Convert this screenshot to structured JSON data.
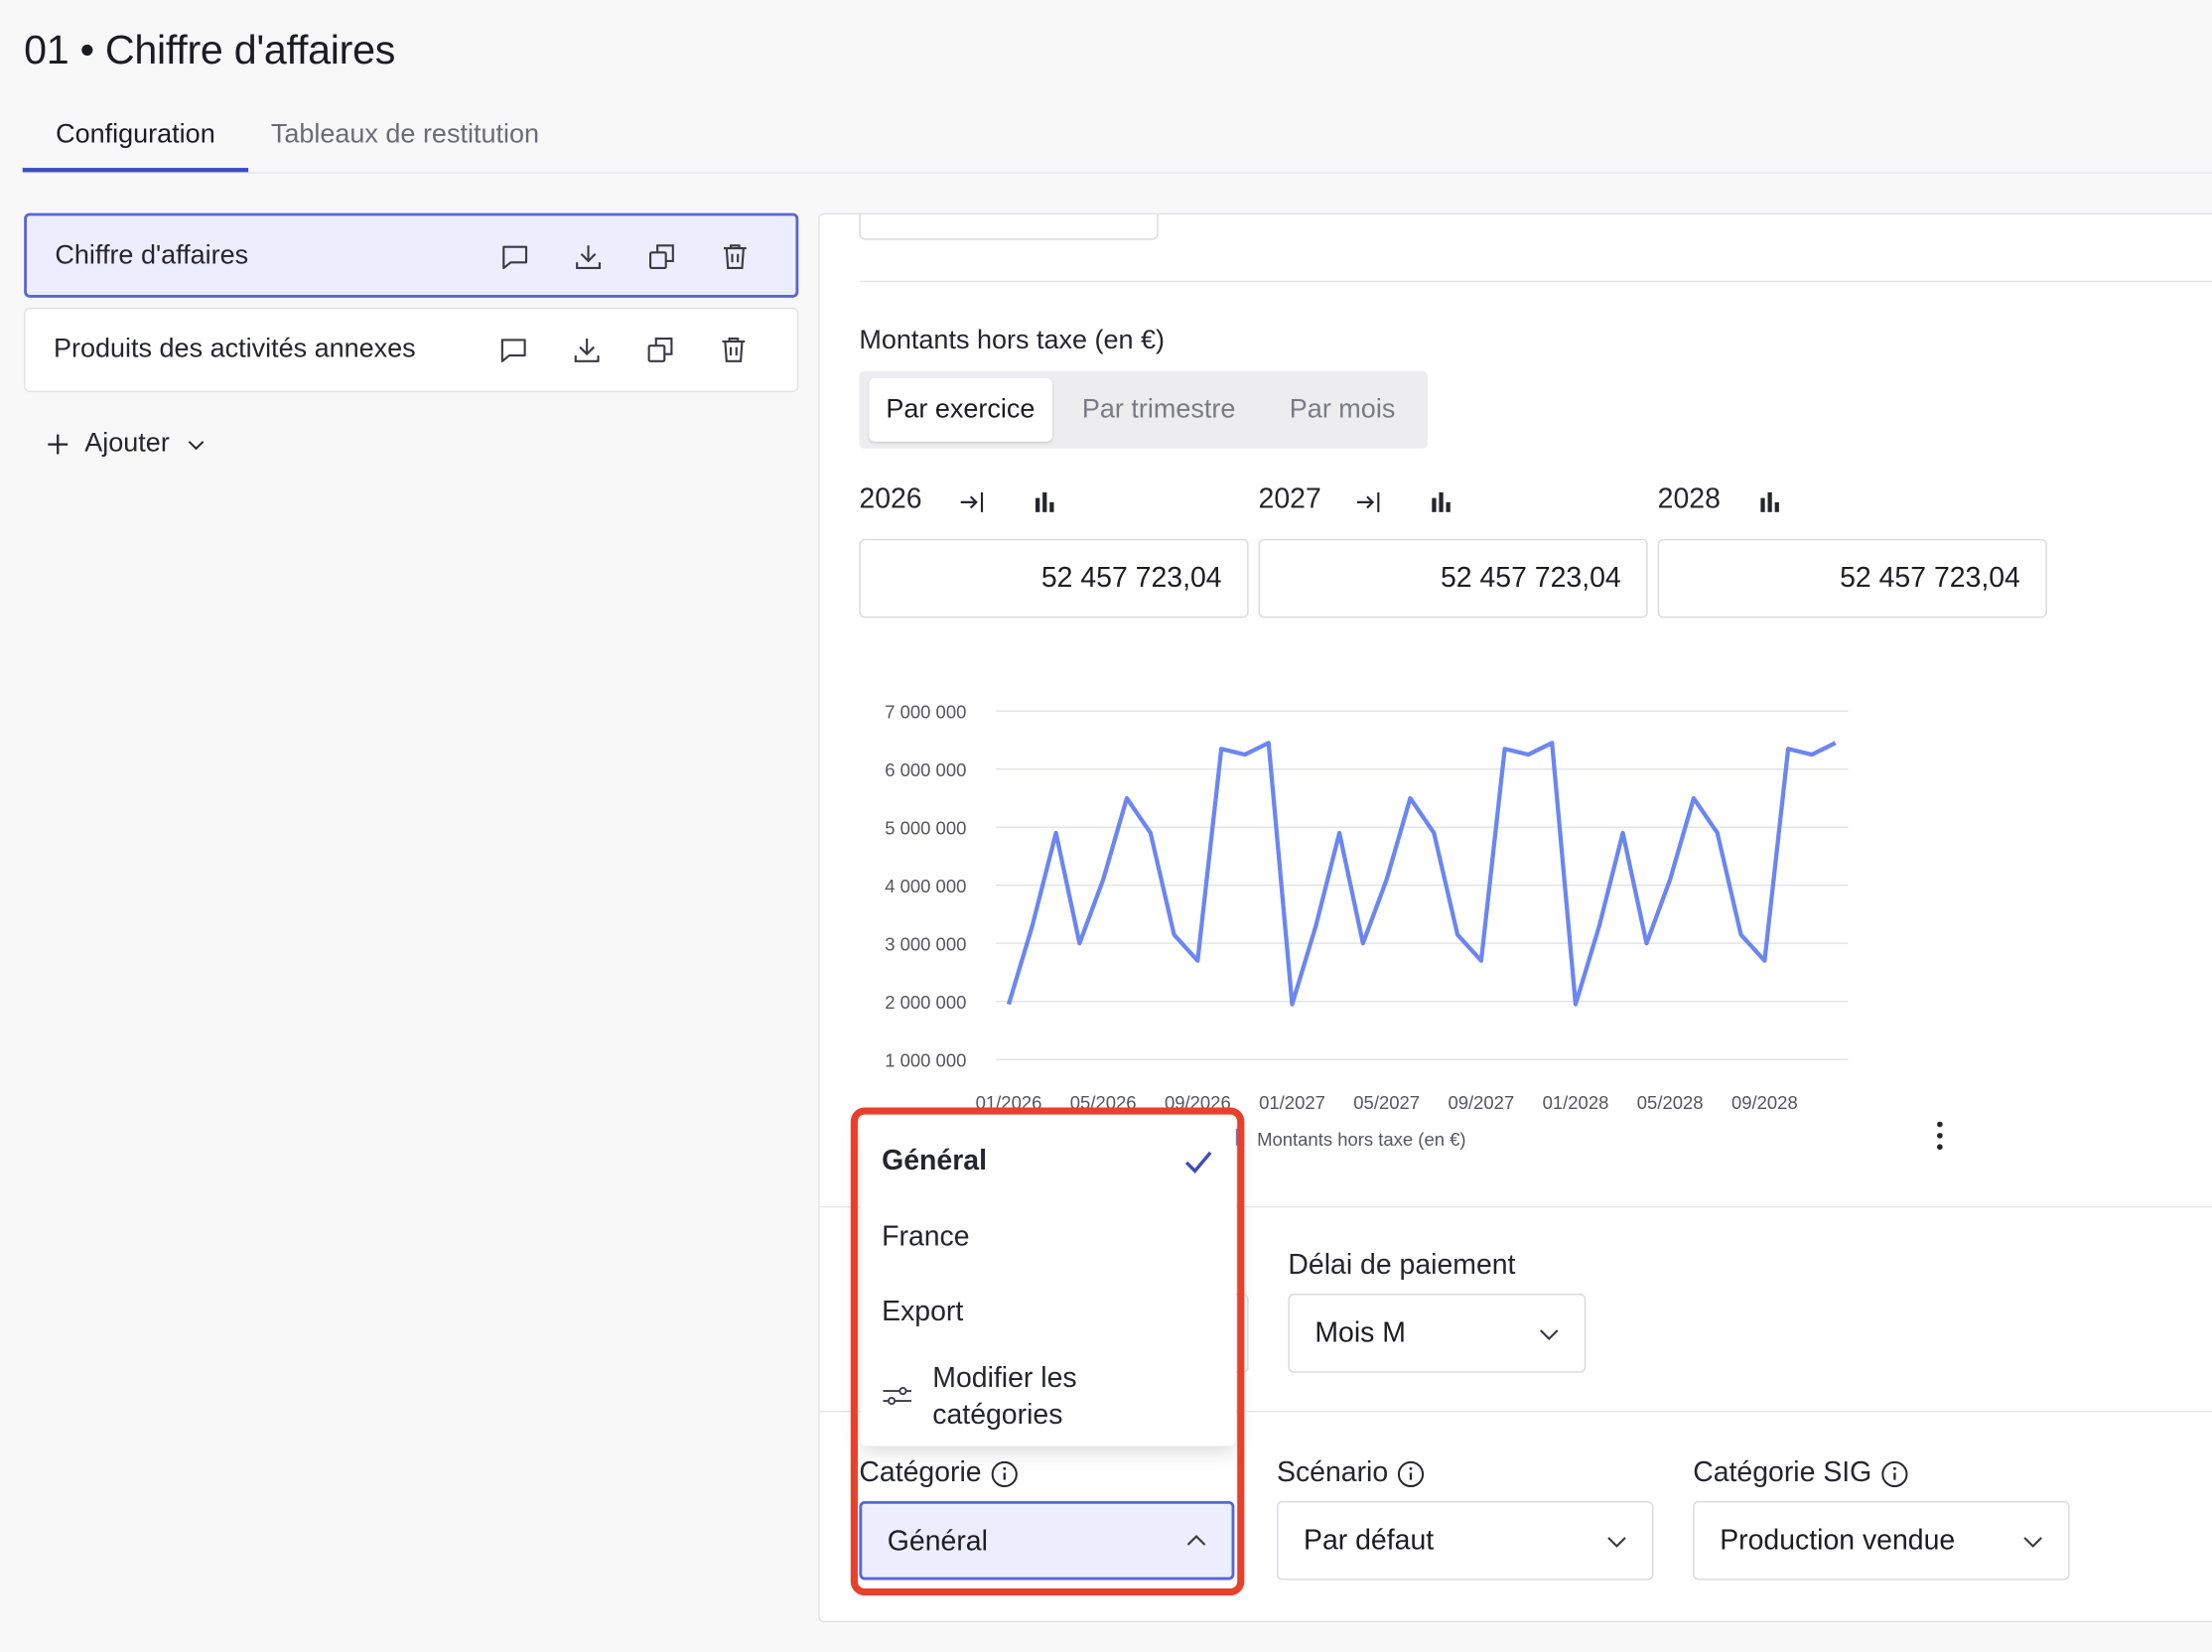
{
  "page": {
    "title": "01 • Chiffre d'affaires"
  },
  "tabs": [
    {
      "label": "Configuration"
    },
    {
      "label": "Tableaux de restitution"
    }
  ],
  "sidebar": {
    "items": [
      {
        "label": "Chiffre d'affaires"
      },
      {
        "label": "Produits des activités annexes"
      }
    ],
    "add_label": "Ajouter"
  },
  "amounts": {
    "title": "Montants hors taxe (en €)",
    "periods": [
      "Par exercice",
      "Par trimestre",
      "Par mois"
    ],
    "years": [
      {
        "year": "2026",
        "value": "52 457 723,04"
      },
      {
        "year": "2027",
        "value": "52 457 723,04"
      },
      {
        "year": "2028",
        "value": "52 457 723,04"
      }
    ]
  },
  "chart_data": {
    "type": "line",
    "x": [
      "01/2026",
      "02/2026",
      "03/2026",
      "04/2026",
      "05/2026",
      "06/2026",
      "07/2026",
      "08/2026",
      "09/2026",
      "10/2026",
      "11/2026",
      "12/2026",
      "01/2027",
      "02/2027",
      "03/2027",
      "04/2027",
      "05/2027",
      "06/2027",
      "07/2027",
      "08/2027",
      "09/2027",
      "10/2027",
      "11/2027",
      "12/2027",
      "01/2028",
      "02/2028",
      "03/2028",
      "04/2028",
      "05/2028",
      "06/2028",
      "07/2028",
      "08/2028",
      "09/2028",
      "10/2028",
      "11/2028",
      "12/2028"
    ],
    "x_tick_labels": [
      "01/2026",
      "05/2026",
      "09/2026",
      "01/2027",
      "05/2027",
      "09/2027",
      "01/2028",
      "05/2028",
      "09/2028"
    ],
    "series": [
      {
        "name": "Montants hors taxe (en €)",
        "color": "#6b86f2",
        "values": [
          1950000,
          3300000,
          4900000,
          3000000,
          4100000,
          5500000,
          4900000,
          3150000,
          2700000,
          6350000,
          6250000,
          6450000,
          1950000,
          3300000,
          4900000,
          3000000,
          4100000,
          5500000,
          4900000,
          3150000,
          2700000,
          6350000,
          6250000,
          6450000,
          1950000,
          3300000,
          4900000,
          3000000,
          4100000,
          5500000,
          4900000,
          3150000,
          2700000,
          6350000,
          6250000,
          6450000
        ]
      }
    ],
    "y_ticks": [
      "1 000 000",
      "2 000 000",
      "3 000 000",
      "4 000 000",
      "5 000 000",
      "6 000 000",
      "7 000 000"
    ],
    "ylim": [
      1000000,
      7000000
    ],
    "grid": true,
    "legend": "bottom"
  },
  "payment": {
    "label": "Délai de paiement",
    "value": "Mois M"
  },
  "category": {
    "label": "Catégorie",
    "value": "Général",
    "options": [
      "Général",
      "France",
      "Export"
    ],
    "edit_label": [
      "Modifier les",
      "catégories"
    ]
  },
  "scenario": {
    "label": "Scénario",
    "value": "Par défaut"
  },
  "sig": {
    "label": "Catégorie SIG",
    "value": "Production vendue"
  },
  "colors": {
    "accent": "#3b4bc0",
    "selected_bg": "#eceefd",
    "line": "#6b86f2",
    "highlight": "#e8402b",
    "check": "#3b4bc0"
  }
}
